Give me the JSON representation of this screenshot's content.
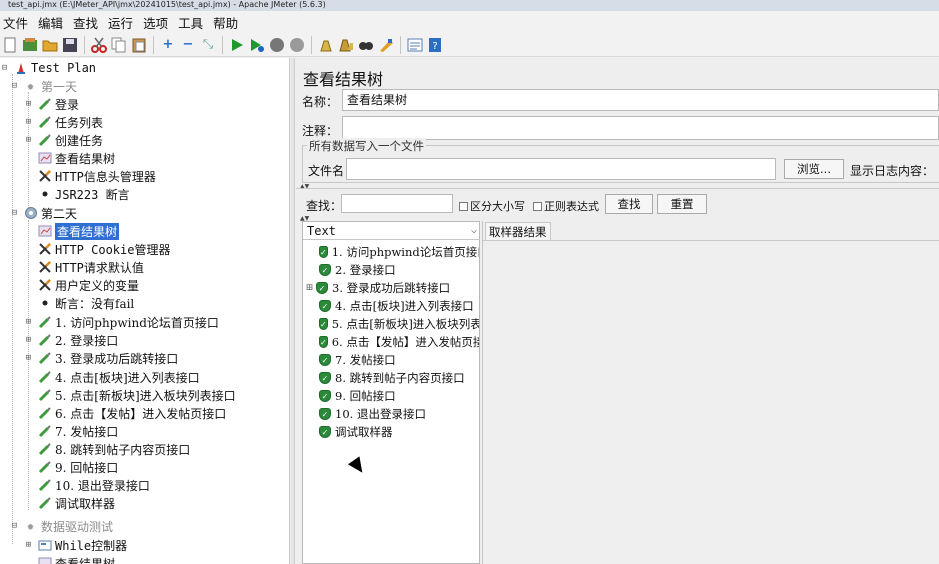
{
  "window": {
    "title": "test_api.jmx (E:\\JMeter_API\\jmx\\20241015\\test_api.jmx) - Apache JMeter (5.6.3)"
  },
  "menu": [
    "文件",
    "编辑",
    "查找",
    "运行",
    "选项",
    "工具",
    "帮助"
  ],
  "toolbar_icons": [
    "new-icon",
    "templates-icon",
    "open-icon",
    "save-icon",
    "cut-icon",
    "copy-icon",
    "paste-icon",
    "expand-icon",
    "collapse-icon",
    "toggle-icon",
    "start-icon",
    "start-no-pause-icon",
    "stop-icon",
    "shutdown-icon",
    "clear-icon",
    "clear-all-icon",
    "search-icon",
    "reset-search-icon",
    "function-helper-icon",
    "help-icon"
  ],
  "tree": {
    "root": "Test Plan",
    "day1": "第一天",
    "day1_items": [
      "登录",
      "任务列表",
      "创建任务",
      "查看结果树",
      "HTTP信息头管理器",
      "JSR223 断言"
    ],
    "day2": "第二天",
    "day2_items": [
      "查看结果树",
      "HTTP Cookie管理器",
      "HTTP请求默认值",
      "用户定义的变量",
      "断言：没有fail",
      "1. 访问phpwind论坛首页接口",
      "2. 登录接口",
      "3. 登录成功后跳转接口",
      "4. 点击[板块]进入列表接口",
      "5. 点击[新板块]进入板块列表接口",
      "6. 点击【发帖】进入发帖页接口",
      "7. 发帖接口",
      "8. 跳转到帖子内容页接口",
      "9. 回帖接口",
      "10. 退出登录接口",
      "调试取样器"
    ],
    "data_group": "数据驱动测试",
    "data_items": [
      "While控制器",
      "查看结果树"
    ]
  },
  "panel": {
    "title": "查看结果树",
    "name_label": "名称：",
    "name_value": "查看结果树",
    "comment_label": "注释：",
    "comment_value": "",
    "file_group_title": "所有数据写入一个文件",
    "filename_label": "文件名",
    "filename_value": "",
    "browse_label": "浏览...",
    "log_label": "显示日志内容：",
    "search_label": "查找：",
    "search_value": "",
    "case_label": "区分大小写",
    "regex_label": "正则表达式",
    "find_button": "查找",
    "reset_button": "重置",
    "renderer": "Text",
    "results": [
      "1. 访问phpwind论坛首页接口",
      "2. 登录接口",
      "3. 登录成功后跳转接口",
      "4. 点击[板块]进入列表接口",
      "5. 点击[新板块]进入板块列表接口",
      "6. 点击【发帖】进入发帖页接口",
      "7. 发帖接口",
      "8. 跳转到帖子内容页接口",
      "9. 回帖接口",
      "10. 退出登录接口",
      "调试取样器"
    ],
    "tab_label": "取样器结果"
  }
}
